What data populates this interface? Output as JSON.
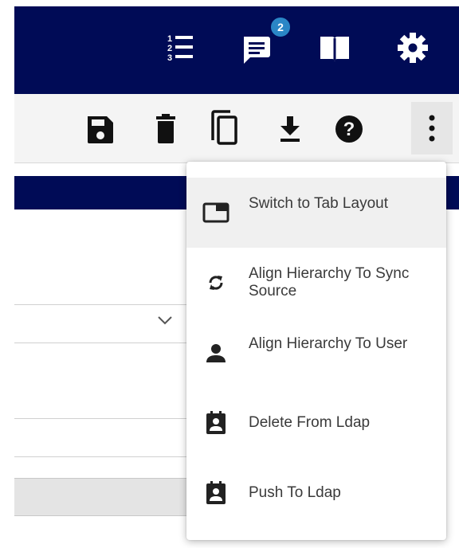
{
  "topbar": {
    "icons": [
      "numbered-list-icon",
      "chat-icon",
      "book-icon",
      "gear-icon"
    ],
    "chat_badge": "2",
    "color": "#000b56",
    "badge_color": "#2a86c6"
  },
  "toolbar": {
    "icons": [
      "save-icon",
      "delete-icon",
      "copy-icon",
      "download-icon",
      "help-icon",
      "more-vertical-icon"
    ]
  },
  "menu": {
    "items": [
      {
        "label": "Switch to Tab Layout",
        "icon": "tab-layout-icon"
      },
      {
        "label": "Align Hierarchy To Sync Source",
        "icon": "sync-icon"
      },
      {
        "label": "Align Hierarchy To User",
        "icon": "person-icon"
      },
      {
        "label": "Delete From Ldap",
        "icon": "contact-badge-icon"
      },
      {
        "label": "Push To Ldap",
        "icon": "contact-badge-icon"
      }
    ]
  }
}
